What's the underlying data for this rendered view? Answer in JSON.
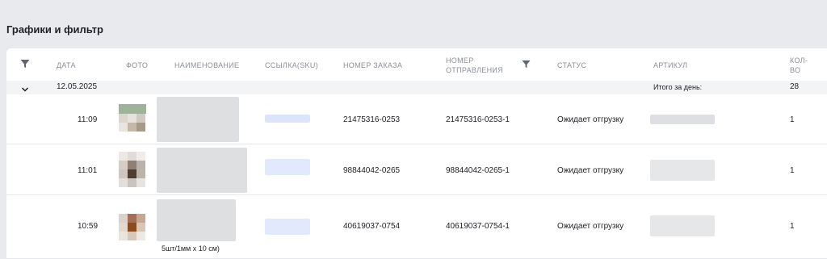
{
  "page": {
    "title": "Графики и фильтр"
  },
  "columns": {
    "date": "ДАТА",
    "photo": "ФОТО",
    "name": "НАИМЕНОВАНИЕ",
    "link": "ССЫЛКА(SKU)",
    "order": "НОМЕР ЗАКАЗА",
    "shipment_line1": "НОМЕР",
    "shipment_line2": "ОТПРАВЛЕНИЯ",
    "status": "СТАТУС",
    "article": "АРТИКУЛ",
    "qty_line1": "КОЛ-",
    "qty_line2": "ВО"
  },
  "group": {
    "date": "12.05.2025",
    "total_label": "Итого за день:",
    "total_value": "28"
  },
  "rows": [
    {
      "time": "11:09",
      "order": "21475316-0253",
      "shipment": "21475316-0253-1",
      "status": "Ожидает отгрузку",
      "qty": "1"
    },
    {
      "time": "11:01",
      "order": "98844042-0265",
      "shipment": "98844042-0265-1",
      "status": "Ожидает отгрузку",
      "qty": "1"
    },
    {
      "time": "10:59",
      "order": "40619037-0754",
      "shipment": "40619037-0754-1",
      "status": "Ожидает отгрузку",
      "qty": "1",
      "name_caption": "5шт/1мм x 10 см)"
    }
  ],
  "icons": {
    "filter": "filter-funnel-icon",
    "chevron": "chevron-down-icon"
  },
  "colors": {
    "header_text": "#8a8f98",
    "group_bg": "#f3f4f6",
    "filter": "#5f6670"
  }
}
